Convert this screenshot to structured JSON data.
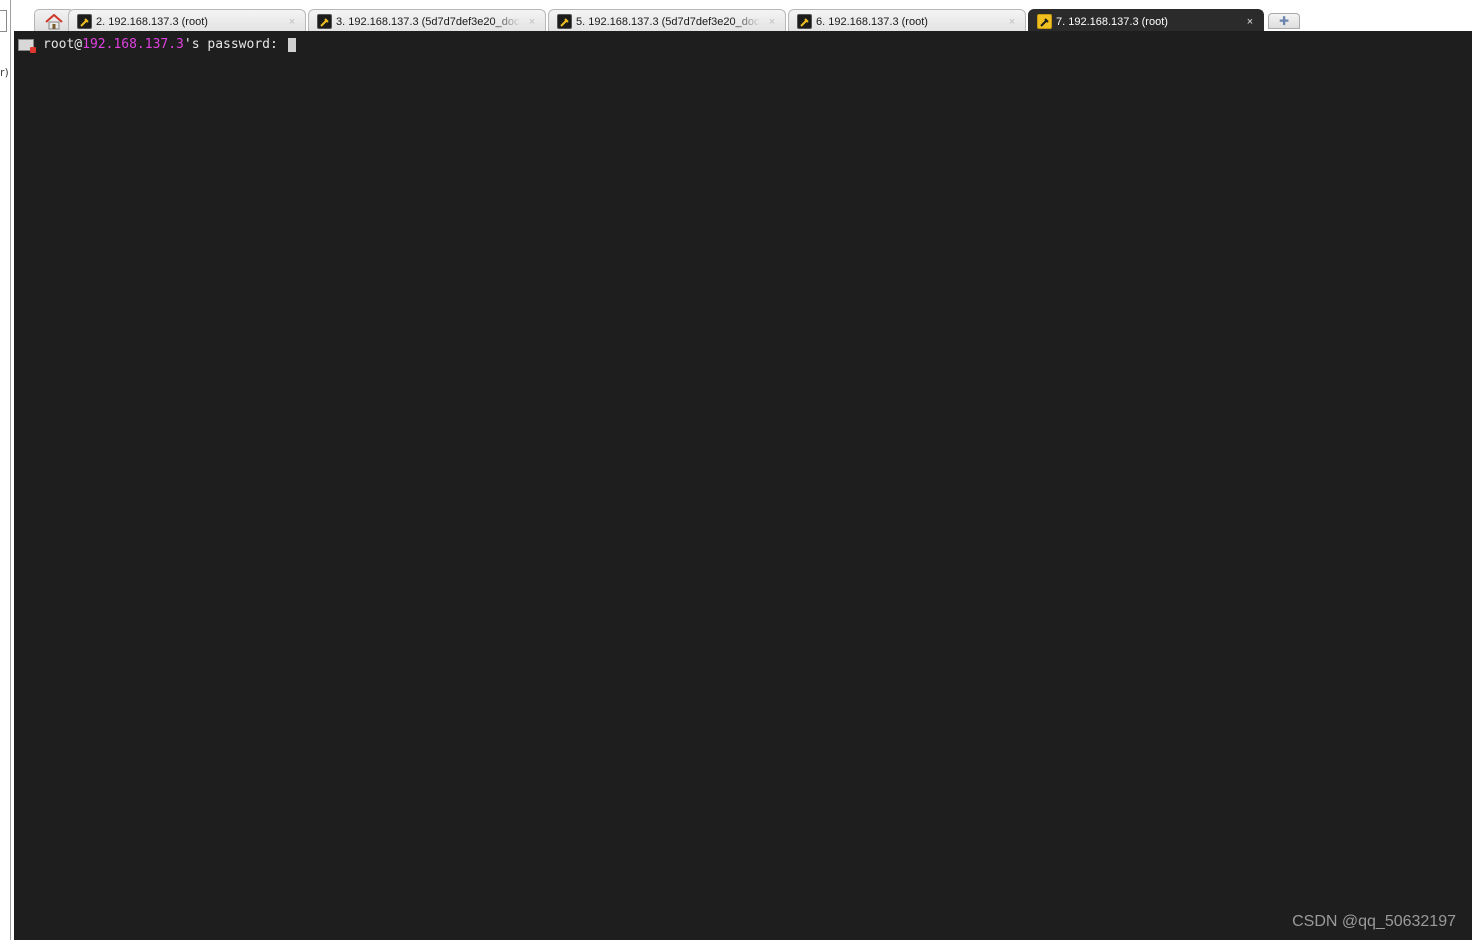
{
  "tabs": {
    "home_icon": "home-icon",
    "items": [
      {
        "label": "2. 192.168.137.3 (root)",
        "close": "×",
        "active": false
      },
      {
        "label": "3. 192.168.137.3 (5d7d7def3e20_doc",
        "close": "×",
        "active": false
      },
      {
        "label": "5. 192.168.137.3 (5d7d7def3e20_doc",
        "close": "×",
        "active": false
      },
      {
        "label": "6. 192.168.137.3 (root)",
        "close": "×",
        "active": false
      },
      {
        "label": "7. 192.168.137.3 (root)",
        "close": "×",
        "active": true
      }
    ],
    "new_tab_symbol": "✚"
  },
  "terminal": {
    "prompt_user": "root@",
    "prompt_host": "192.168.137.3",
    "prompt_suffix": "'s password: "
  },
  "watermark": "CSDN @qq_50632197",
  "colors": {
    "terminal_bg": "#1e1e1e",
    "host_color": "#e040e0",
    "active_tab_bg": "#2b2b2b"
  }
}
